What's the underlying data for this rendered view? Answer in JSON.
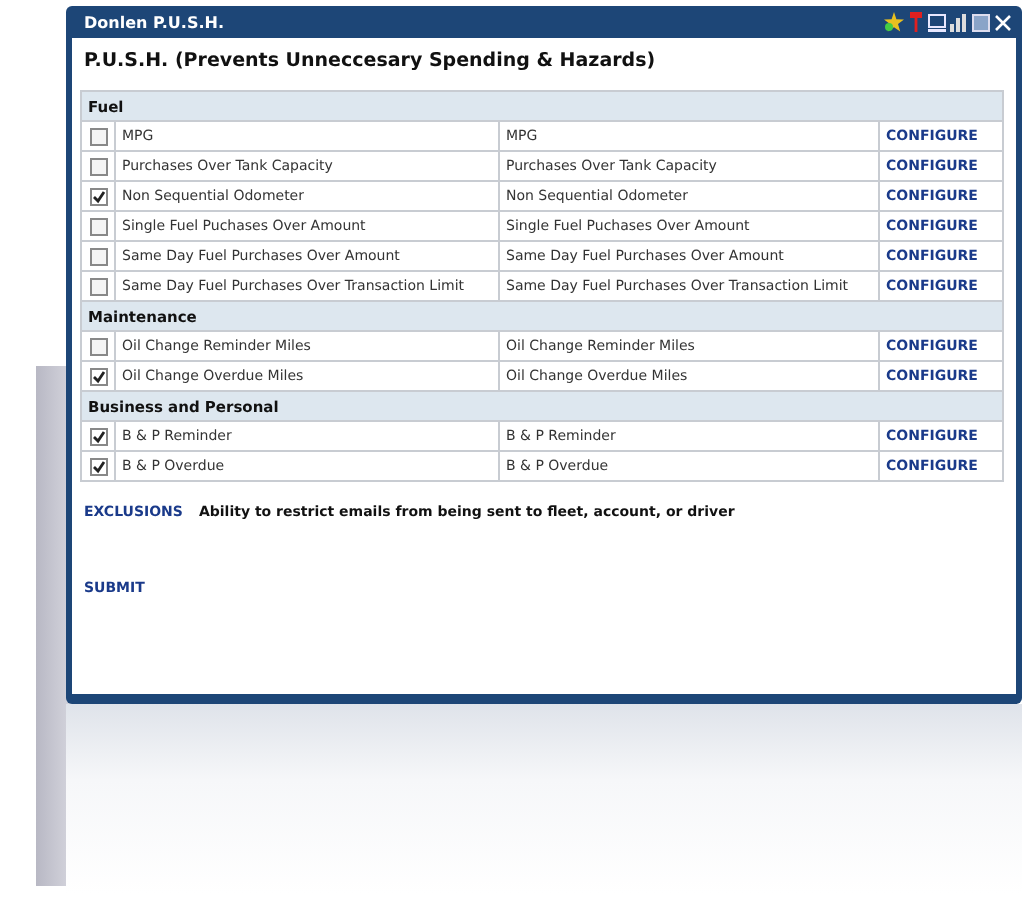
{
  "window": {
    "title": "Donlen P.U.S.H."
  },
  "heading": "P.U.S.H. (Prevents Unneccesary Spending & Hazards)",
  "sections": [
    {
      "title": "Fuel",
      "rows": [
        {
          "checked": false,
          "name": "MPG",
          "description": "MPG",
          "action": "CONFIGURE"
        },
        {
          "checked": false,
          "name": "Purchases Over Tank Capacity",
          "description": "Purchases Over Tank Capacity",
          "action": "CONFIGURE"
        },
        {
          "checked": true,
          "name": "Non Sequential Odometer",
          "description": "Non Sequential Odometer",
          "action": "CONFIGURE"
        },
        {
          "checked": false,
          "name": "Single Fuel Puchases Over Amount",
          "description": "Single Fuel Puchases Over Amount",
          "action": "CONFIGURE"
        },
        {
          "checked": false,
          "name": "Same Day Fuel Purchases Over Amount",
          "description": "Same Day Fuel Purchases Over Amount",
          "action": "CONFIGURE"
        },
        {
          "checked": false,
          "name": "Same Day Fuel Purchases Over Transaction Limit",
          "description": "Same Day Fuel Purchases Over Transaction Limit",
          "action": "CONFIGURE"
        }
      ]
    },
    {
      "title": "Maintenance",
      "rows": [
        {
          "checked": false,
          "name": "Oil Change Reminder Miles",
          "description": "Oil Change Reminder Miles",
          "action": "CONFIGURE"
        },
        {
          "checked": true,
          "name": "Oil Change Overdue Miles",
          "description": "Oil Change Overdue Miles",
          "action": "CONFIGURE"
        }
      ]
    },
    {
      "title": "Business and Personal",
      "rows": [
        {
          "checked": true,
          "name": "B & P Reminder",
          "description": "B & P Reminder",
          "action": "CONFIGURE"
        },
        {
          "checked": true,
          "name": "B & P Overdue",
          "description": "B & P Overdue",
          "action": "CONFIGURE"
        }
      ]
    }
  ],
  "exclusions": {
    "link": "EXCLUSIONS",
    "text": "Ability to restrict emails from being sent to fleet, account, or driver"
  },
  "submit": "SUBMIT"
}
